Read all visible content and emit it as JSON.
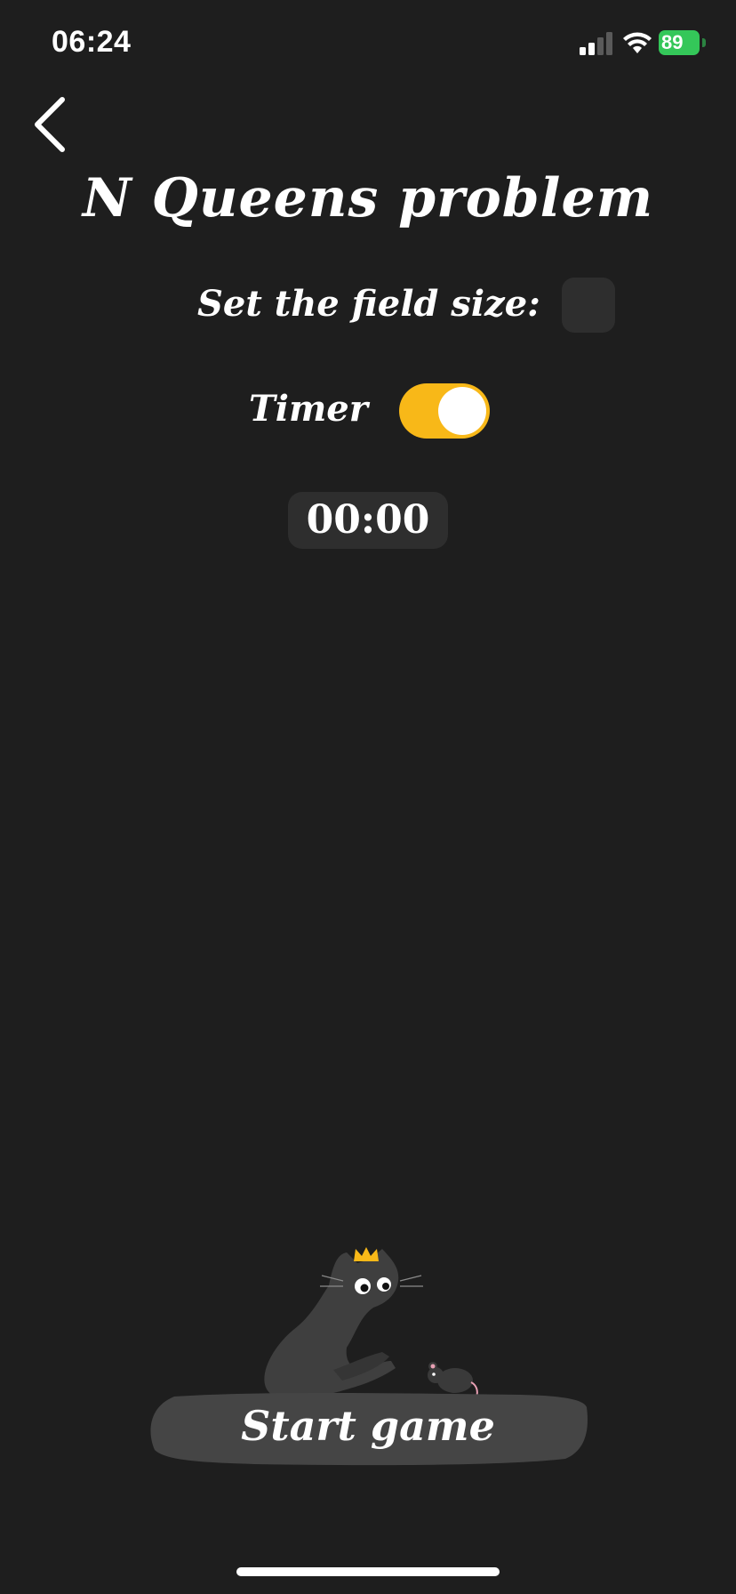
{
  "status_bar": {
    "time": "06:24",
    "battery_percent": "89",
    "signal_icon": "cellular-signal-icon",
    "wifi_icon": "wifi-icon",
    "battery_icon": "battery-charging-icon"
  },
  "nav": {
    "back_icon": "chevron-left-icon"
  },
  "title": "N Queens problem",
  "settings": {
    "field_size_label": "Set the field size:",
    "field_size_value": "",
    "timer_label": "Timer",
    "timer_enabled": true
  },
  "timer": {
    "display": "00:00"
  },
  "start_button": {
    "label": "Start game"
  },
  "colors": {
    "background": "#1e1e1e",
    "accent": "#f8b818",
    "surface": "#2e2e2e",
    "battery_green": "#34c759"
  }
}
